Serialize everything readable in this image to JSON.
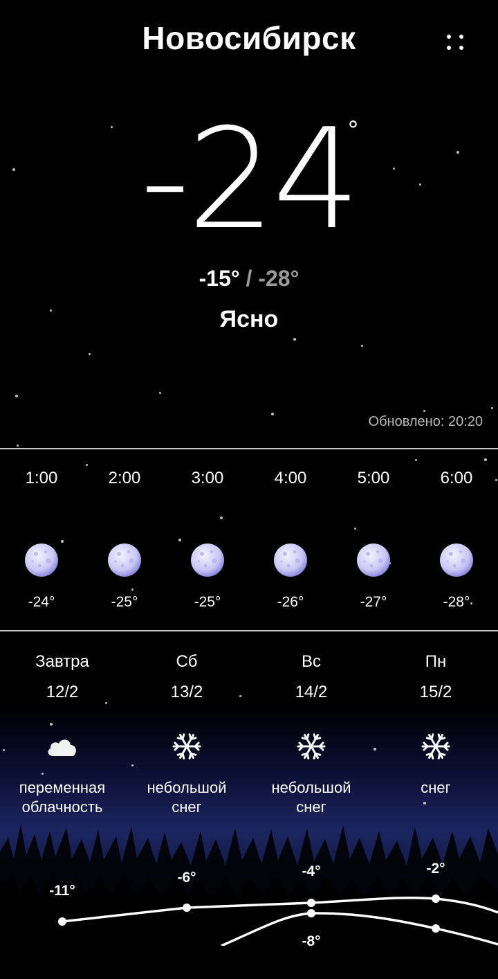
{
  "header": {
    "city": "Новосибирск"
  },
  "current": {
    "temperature": "-24",
    "degree_symbol": "°",
    "high": "-15°",
    "separator": "/",
    "low": "-28°",
    "condition": "Ясно",
    "updated": "Обновлено: 20:20"
  },
  "hourly": [
    {
      "time": "1:00",
      "temp": "-24°",
      "icon": "moon-icon"
    },
    {
      "time": "2:00",
      "temp": "-25°",
      "icon": "moon-icon"
    },
    {
      "time": "3:00",
      "temp": "-25°",
      "icon": "moon-icon"
    },
    {
      "time": "4:00",
      "temp": "-26°",
      "icon": "moon-icon"
    },
    {
      "time": "5:00",
      "temp": "-27°",
      "icon": "moon-icon"
    },
    {
      "time": "6:00",
      "temp": "-28°",
      "icon": "moon-icon"
    }
  ],
  "daily": [
    {
      "day": "Завтра",
      "date": "12/2",
      "icon": "cloud-icon",
      "desc_line1": "переменная",
      "desc_line2": "облачность",
      "high": "-11°"
    },
    {
      "day": "Сб",
      "date": "13/2",
      "icon": "snowflake-icon",
      "desc_line1": "небольшой",
      "desc_line2": "снег",
      "high": "-6°"
    },
    {
      "day": "Вс",
      "date": "14/2",
      "icon": "snowflake-icon",
      "desc_line1": "небольшой",
      "desc_line2": "снег",
      "high": "-4°",
      "low": "-8°"
    },
    {
      "day": "Пн",
      "date": "15/2",
      "icon": "snowflake-icon",
      "desc_line1": "снег",
      "desc_line2": "",
      "high": "-2°"
    }
  ]
}
